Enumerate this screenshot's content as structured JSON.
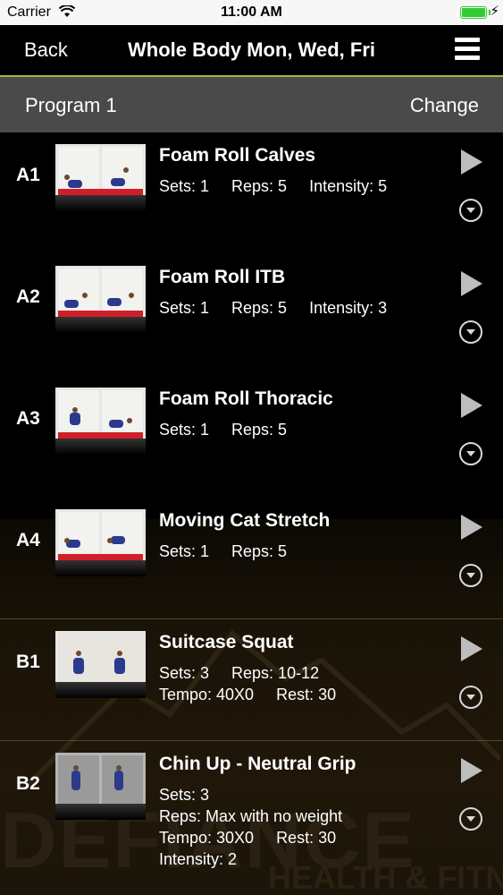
{
  "status_bar": {
    "carrier": "Carrier",
    "time": "11:00 AM",
    "battery_charging": "⚡"
  },
  "nav": {
    "back_label": "Back",
    "title": "Whole Body Mon, Wed, Fri"
  },
  "program": {
    "label": "Program 1",
    "change_label": "Change"
  },
  "background": {
    "word": "DEFIANCE",
    "subword": "HEALTH & FITNESS"
  },
  "exercises": [
    {
      "code": "A1",
      "name": "Foam Roll Calves",
      "lines": [
        "Sets: 1     Reps: 5     Intensity: 5"
      ]
    },
    {
      "code": "A2",
      "name": "Foam Roll ITB",
      "lines": [
        "Sets: 1     Reps: 5     Intensity: 3"
      ]
    },
    {
      "code": "A3",
      "name": "Foam Roll Thoracic",
      "lines": [
        "Sets: 1     Reps: 5"
      ]
    },
    {
      "code": "A4",
      "name": "Moving Cat Stretch",
      "lines": [
        "Sets: 1     Reps: 5"
      ]
    },
    {
      "code": "B1",
      "name": "Suitcase Squat",
      "lines": [
        "Sets: 3     Reps: 10-12",
        "Tempo: 40X0     Rest: 30"
      ]
    },
    {
      "code": "B2",
      "name": "Chin Up - Neutral Grip",
      "lines": [
        "Sets: 3",
        "Reps: Max with no weight",
        "Tempo: 30X0     Rest: 30",
        "Intensity: 2"
      ]
    }
  ],
  "colors": {
    "nav_accent": "#9fb83a",
    "program_bar": "#4a4a4a",
    "battery": "#33cc33"
  }
}
